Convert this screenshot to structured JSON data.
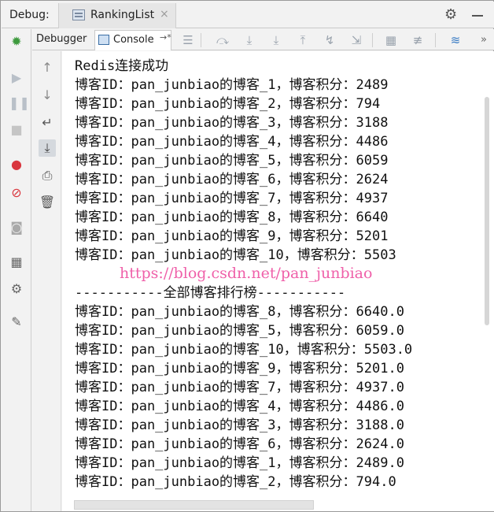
{
  "header": {
    "debug_label": "Debug:",
    "run_tab_title": "RankingList",
    "run_tab_close": "×"
  },
  "tabs": {
    "debugger": "Debugger",
    "console": "Console",
    "console_pin": "→*"
  },
  "icons": {
    "settings": "gear-icon",
    "minimize": "minimize-icon",
    "more": "more-icon"
  },
  "console": {
    "lines": [
      "Redis连接成功",
      "博客ID：pan_junbiao的博客_1，博客积分：2489",
      "博客ID：pan_junbiao的博客_2，博客积分：794",
      "博客ID：pan_junbiao的博客_3，博客积分：3188",
      "博客ID：pan_junbiao的博客_4，博客积分：4486",
      "博客ID：pan_junbiao的博客_5，博客积分：6059",
      "博客ID：pan_junbiao的博客_6，博客积分：2624",
      "博客ID：pan_junbiao的博客_7，博客积分：4937",
      "博客ID：pan_junbiao的博客_8，博客积分：6640",
      "博客ID：pan_junbiao的博客_9，博客积分：5201",
      "博客ID：pan_junbiao的博客_10，博客积分：5503",
      "",
      "-----------全部博客排行榜-----------",
      "博客ID：pan_junbiao的博客_8，博客积分：6640.0",
      "博客ID：pan_junbiao的博客_5，博客积分：6059.0",
      "博客ID：pan_junbiao的博客_10，博客积分：5503.0",
      "博客ID：pan_junbiao的博客_9，博客积分：5201.0",
      "博客ID：pan_junbiao的博客_7，博客积分：4937.0",
      "博客ID：pan_junbiao的博客_4，博客积分：4486.0",
      "博客ID：pan_junbiao的博客_3，博客积分：3188.0",
      "博客ID：pan_junbiao的博客_6，博客积分：2624.0",
      "博客ID：pan_junbiao的博客_1，博客积分：2489.0",
      "博客ID：pan_junbiao的博客_2，博客积分：794.0"
    ],
    "watermark": "https://blog.csdn.net/pan_junbiao"
  },
  "colors": {
    "accent": "#3a6ea5",
    "watermark": "#ee4fa0",
    "debug_bug": "#3d9a3d",
    "breakpoint": "#d9363e"
  }
}
